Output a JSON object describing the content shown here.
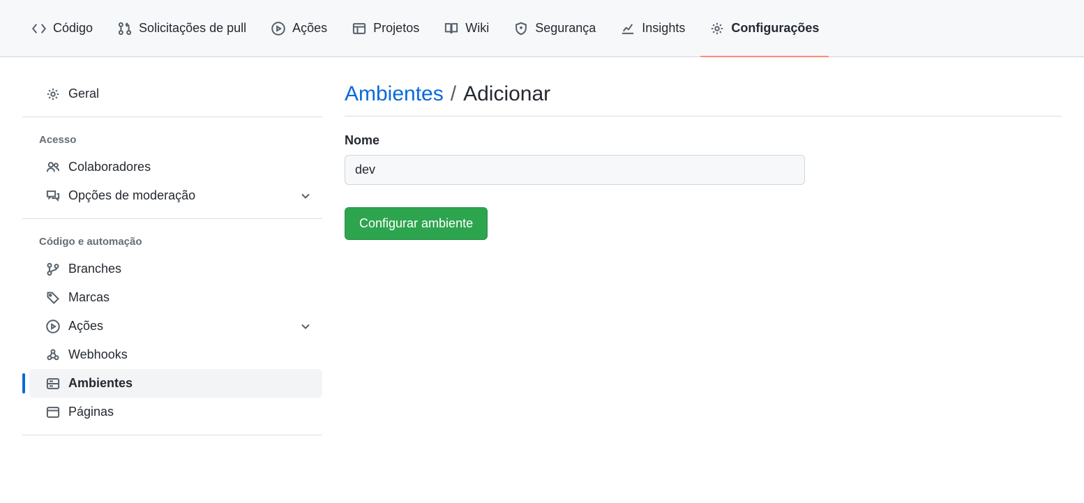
{
  "topnav": {
    "items": [
      {
        "label": "Código"
      },
      {
        "label": "Solicitações de pull"
      },
      {
        "label": "Ações"
      },
      {
        "label": "Projetos"
      },
      {
        "label": "Wiki"
      },
      {
        "label": "Segurança"
      },
      {
        "label": "Insights"
      },
      {
        "label": "Configurações"
      }
    ]
  },
  "sidebar": {
    "general": {
      "label": "Geral"
    },
    "groups": [
      {
        "title": "Acesso",
        "items": [
          {
            "label": "Colaboradores"
          },
          {
            "label": "Opções de moderação",
            "expandable": true
          }
        ]
      },
      {
        "title": "Código e automação",
        "items": [
          {
            "label": "Branches"
          },
          {
            "label": "Marcas"
          },
          {
            "label": "Ações",
            "expandable": true
          },
          {
            "label": "Webhooks"
          },
          {
            "label": "Ambientes",
            "active": true
          },
          {
            "label": "Páginas"
          }
        ]
      }
    ]
  },
  "main": {
    "breadcrumb_link": "Ambientes",
    "breadcrumb_sep": "/",
    "breadcrumb_current": "Adicionar",
    "form": {
      "name_label": "Nome",
      "name_value": "dev",
      "submit_label": "Configurar ambiente"
    }
  }
}
